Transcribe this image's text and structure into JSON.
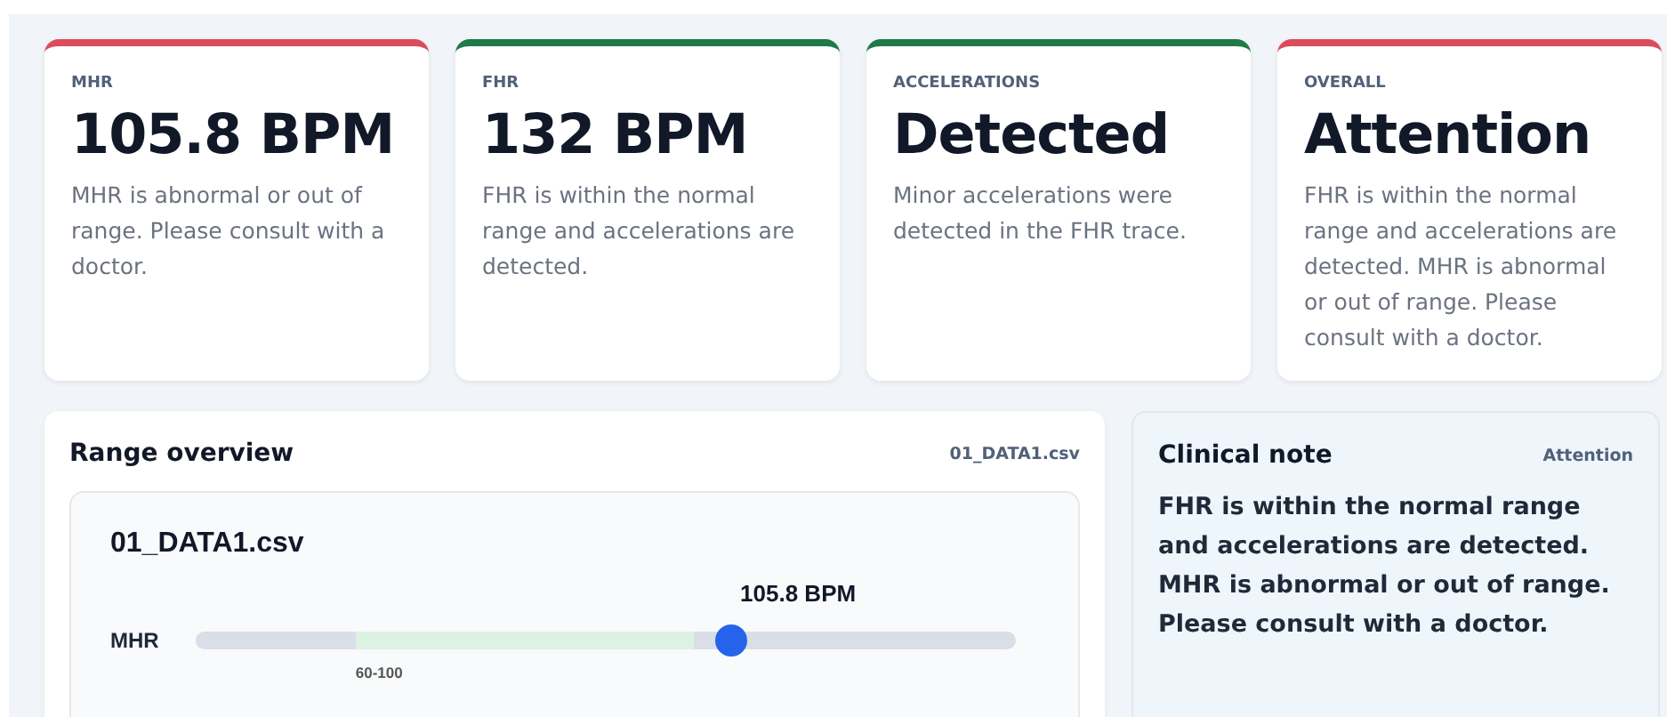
{
  "cards": [
    {
      "label": "MHR",
      "value": "105.8 BPM",
      "description": "MHR is abnormal or out of range. Please consult with a doctor.",
      "color": "#dc4c5c"
    },
    {
      "label": "FHR",
      "value": "132 BPM",
      "description": "FHR is within the normal range and accelerations are detected.",
      "color": "#1e7a46"
    },
    {
      "label": "ACCELERATIONS",
      "value": "Detected",
      "description": "Minor accelerations were detected in the FHR trace.",
      "color": "#1e7a46"
    },
    {
      "label": "OVERALL",
      "value": "Attention",
      "description": "FHR is within the normal range and accelerations are detected. MHR is abnormal or out of range. Please consult with a doctor.",
      "color": "#dc4c5c"
    }
  ],
  "range_overview": {
    "title": "Range overview",
    "file": "01_DATA1.csv",
    "chart_title": "01_DATA1.csv",
    "rows": [
      {
        "label": "MHR",
        "reading": "105.8 BPM",
        "range_label": "60-100",
        "level": 0.653
      }
    ]
  },
  "clinical_note": {
    "title": "Clinical note",
    "status": "Attention",
    "text": "FHR is within the normal range and accelerations are detected. MHR is abnormal or out of range. Please consult with a doctor."
  }
}
